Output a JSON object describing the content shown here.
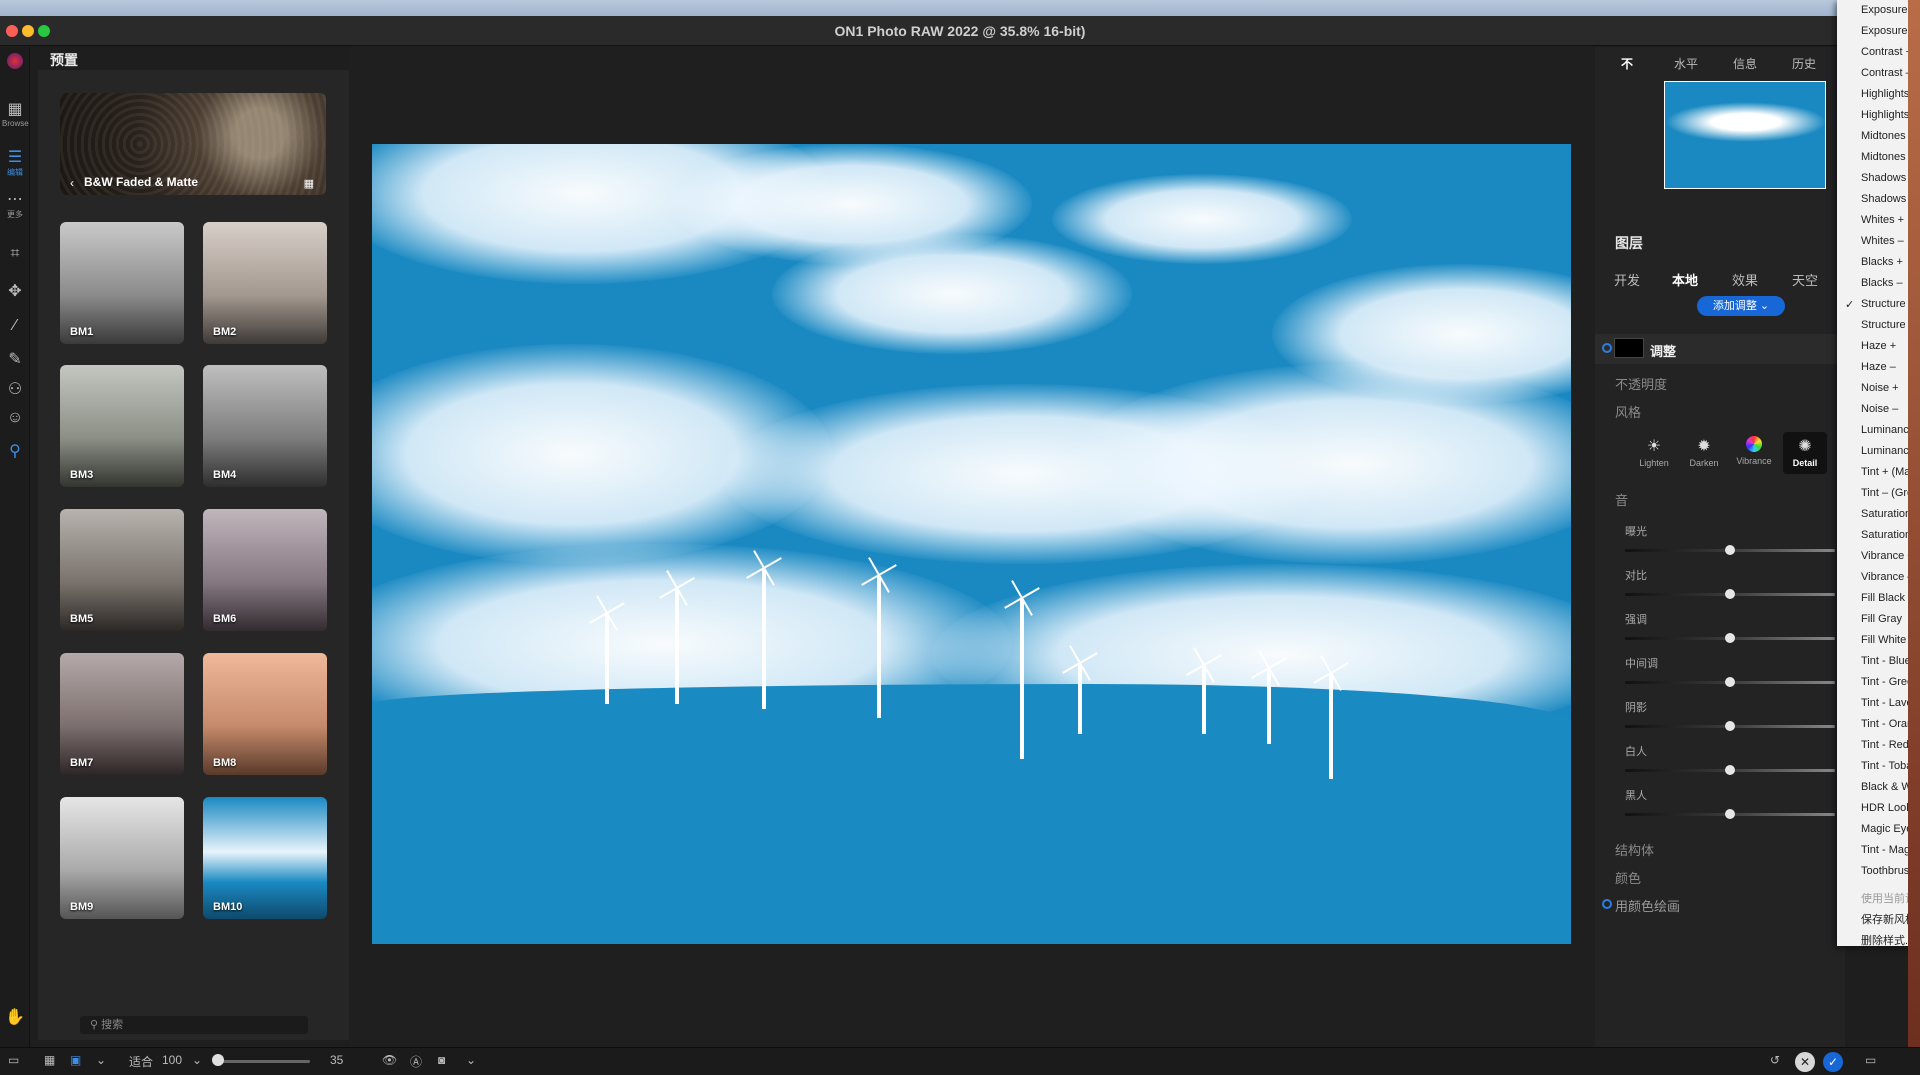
{
  "window": {
    "title": "ON1 Photo RAW 2022 @ 35.8% 16-bit)"
  },
  "left_toolbar": {
    "browse_label": "Browse",
    "edit_label": "编辑",
    "more_label": "更多"
  },
  "presets": {
    "panel_title": "预置",
    "category": "B&W Faded & Matte",
    "items": [
      {
        "label": "BM1"
      },
      {
        "label": "BM2"
      },
      {
        "label": "BM3"
      },
      {
        "label": "BM4"
      },
      {
        "label": "BM5"
      },
      {
        "label": "BM6"
      },
      {
        "label": "BM7"
      },
      {
        "label": "BM8"
      },
      {
        "label": "BM9"
      },
      {
        "label": "BM10"
      }
    ],
    "search_placeholder": "搜索"
  },
  "right_panel": {
    "top_tabs": [
      "不",
      "水平",
      "信息",
      "历史"
    ],
    "layers_heading": "图层",
    "module_tabs": [
      "开发",
      "本地",
      "效果",
      "天空"
    ],
    "add_adjustment": "添加调整",
    "adjustment_label": "调整",
    "opacity_label": "不透明度",
    "style_label": "风格",
    "style_buttons": [
      "Lighten",
      "Darken",
      "Vibrance",
      "Detail"
    ],
    "tone_label": "音",
    "sliders": [
      {
        "label": "曝光",
        "value": 0
      },
      {
        "label": "对比",
        "value": 0
      },
      {
        "label": "强调",
        "value": 0
      },
      {
        "label": "中间调",
        "value": 0
      },
      {
        "label": "阴影",
        "value": 0
      },
      {
        "label": "白人",
        "value": 0
      },
      {
        "label": "黑人",
        "value": 0
      }
    ],
    "structure_label": "结构体",
    "color_label": "颜色",
    "paint_with_color": "用颜色绘画"
  },
  "dropdown_menu": {
    "checked_item": "Structure +",
    "items": [
      "Exposure +",
      "Exposure –",
      "Contrast +",
      "Contrast –",
      "Highlights +",
      "Highlights –",
      "Midtones +",
      "Midtones –",
      "Shadows +",
      "Shadows –",
      "Whites +",
      "Whites –",
      "Blacks +",
      "Blacks –",
      "Structure +",
      "Structure –",
      "Haze +",
      "Haze –",
      "Noise +",
      "Noise –",
      "Luminance +",
      "Luminance –",
      "Tint + (Mag",
      "Tint – (Gree",
      "Saturation +",
      "Saturation –",
      "Vibrance +",
      "Vibrance –",
      "Fill Black",
      "Fill Gray",
      "Fill White",
      "Tint - Blue",
      "Tint - Green",
      "Tint - Laven",
      "Tint - Orang",
      "Tint - Red",
      "Tint - Tobac",
      "Black & Whi",
      "HDR Look",
      "Magic Eye F",
      "Tint - Mager",
      "Toothbrush"
    ],
    "footer_items": [
      "使用当前设",
      "保存新风格",
      "删除样式..."
    ]
  },
  "bottom_bar": {
    "fit_label": "适合",
    "zoom_value": "100",
    "slider_value": "35"
  },
  "colors": {
    "accent": "#1767d6",
    "photo_blue": "#1a89c2"
  }
}
